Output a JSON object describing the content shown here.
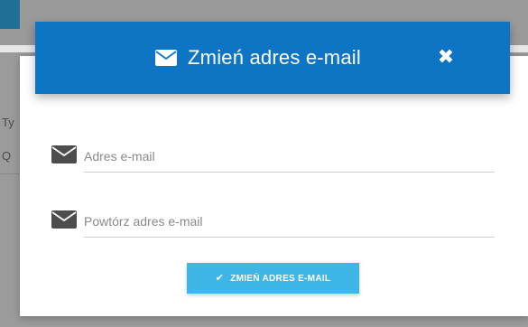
{
  "background": {
    "text_1": "Ty",
    "text_2": "Q"
  },
  "modal": {
    "title": "Zmień adres e-mail",
    "header_icon": "envelope-icon",
    "close_icon": "close-icon",
    "close_glyph": "✖",
    "fields": [
      {
        "icon": "envelope-icon",
        "placeholder": "Adres e-mail",
        "value": ""
      },
      {
        "icon": "envelope-icon",
        "placeholder": "Powtórz adres e-mail",
        "value": ""
      }
    ],
    "submit": {
      "icon": "check-icon",
      "glyph": "✔",
      "label": "ZMIEŃ ADRES E-MAIL"
    }
  },
  "colors": {
    "header": "#0d75c4",
    "button": "#3fb6e8",
    "icon": "#4d4d4d"
  }
}
